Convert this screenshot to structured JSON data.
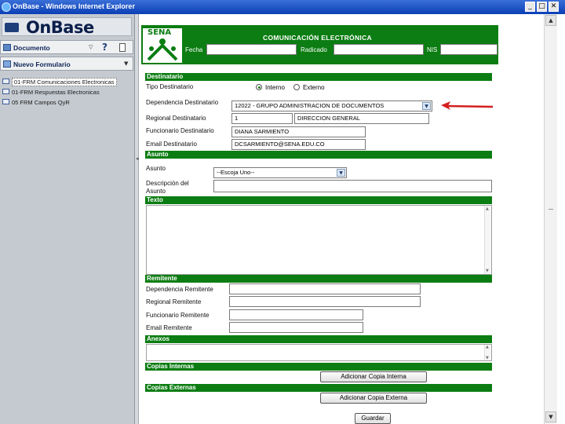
{
  "window": {
    "title": "OnBase - Windows Internet Explorer"
  },
  "window_buttons": {
    "minimize": "_",
    "maximize": "□",
    "close": "✕"
  },
  "sidebar": {
    "logo": "OnBase",
    "doc_dropdown": {
      "label": "Documento",
      "caret": "▽",
      "help": "?"
    },
    "form_dropdown": {
      "label": "Nuevo Formulario",
      "caret": "▼"
    },
    "items": [
      {
        "label": "01-FRM Comunicaciones Electronicas"
      },
      {
        "label": "01-FRM Respuestas Electronicas"
      },
      {
        "label": "05 FRM Campos QyR"
      }
    ]
  },
  "form": {
    "header": {
      "logo_text": "SENA",
      "title": "COMUNICACIÓN ELECTRÓNICA",
      "fecha_label": "Fecha",
      "radicado_label": "Radicado",
      "nis_label": "NIS"
    },
    "destinatario": {
      "section": "Destinatario",
      "tipo_label": "Tipo Destinatario",
      "options": [
        "Interno",
        "Externo"
      ],
      "selected": "Interno",
      "dependencia_label": "Dependencia Destinatario",
      "dependencia_value": "12022 - GRUPO ADMINISTRACION DE DOCUMENTOS",
      "regional_label": "Regional Destinatario",
      "regional_code": "1",
      "regional_name": "DIRECCION GENERAL",
      "funcionario_label": "Funcionario Destinatario",
      "funcionario_value": "DIANA SARMIENTO",
      "email_label": "Email Destinatario",
      "email_value": "DCSARMIENTO@SENA.EDU.CO"
    },
    "asunto": {
      "section": "Asunto",
      "asunto_label": "Asunto",
      "asunto_value": "--Escoja Uno--",
      "descripcion_label_1": "Descripción del",
      "descripcion_label_2": "Asunto"
    },
    "texto": {
      "section": "Texto"
    },
    "remitente": {
      "section": "Remitente",
      "dependencia_label": "Dependencia Remitente",
      "regional_label": "Regional Remitente",
      "funcionario_label": "Funcionario Remitente",
      "email_label": "Email Remitente"
    },
    "anexos": {
      "section": "Anexos"
    },
    "copias_internas": {
      "section": "Copias Internas",
      "button": "Adicionar Copia Interna"
    },
    "copias_externas": {
      "section": "Copias Externas",
      "button": "Adicionar Copia Externa"
    },
    "guardar_button": "Guardar"
  },
  "colors": {
    "sena_green": "#0b7d12",
    "annotation_arrow": "#d42020",
    "sidebar_bg": "#c5cad0"
  },
  "annotation": {
    "type": "arrow",
    "points_to": "dependencia-destinatario-select"
  }
}
